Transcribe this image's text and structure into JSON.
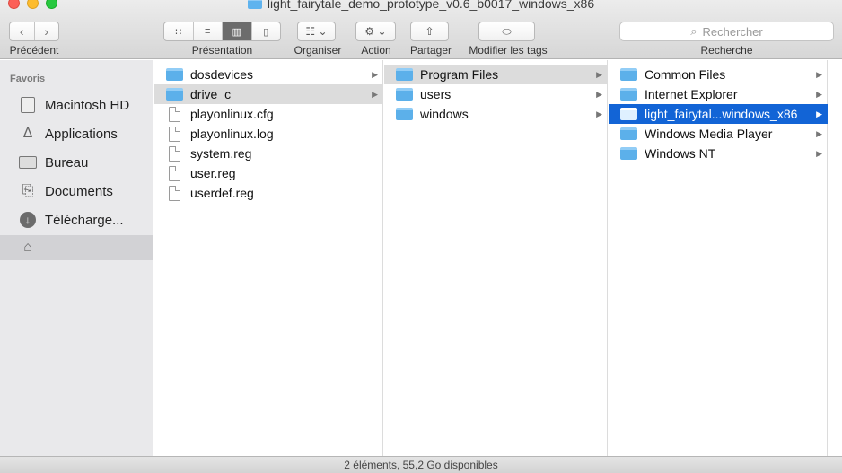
{
  "window": {
    "title": "light_fairytale_demo_prototype_v0.6_b0017_windows_x86"
  },
  "toolbar": {
    "back_label": "Précédent",
    "view_label": "Présentation",
    "arrange_label": "Organiser",
    "action_label": "Action",
    "share_label": "Partager",
    "tags_label": "Modifier les tags",
    "search_label": "Recherche",
    "search_placeholder": "Rechercher"
  },
  "sidebar": {
    "header": "Favoris",
    "items": [
      {
        "label": "Macintosh HD",
        "icon": "hard-drive-icon"
      },
      {
        "label": "Applications",
        "icon": "applications-icon"
      },
      {
        "label": "Bureau",
        "icon": "desktop-icon"
      },
      {
        "label": "Documents",
        "icon": "documents-icon"
      },
      {
        "label": "Télécharge...",
        "icon": "downloads-icon"
      },
      {
        "label": "",
        "icon": "home-icon"
      }
    ]
  },
  "columns": [
    {
      "items": [
        {
          "name": "dosdevices",
          "type": "folder"
        },
        {
          "name": "drive_c",
          "type": "folder",
          "selected": "gray"
        },
        {
          "name": "playonlinux.cfg",
          "type": "file"
        },
        {
          "name": "playonlinux.log",
          "type": "file"
        },
        {
          "name": "system.reg",
          "type": "file"
        },
        {
          "name": "user.reg",
          "type": "file"
        },
        {
          "name": "userdef.reg",
          "type": "file"
        }
      ]
    },
    {
      "items": [
        {
          "name": "Program Files",
          "type": "folder",
          "selected": "gray"
        },
        {
          "name": "users",
          "type": "folder"
        },
        {
          "name": "windows",
          "type": "folder"
        }
      ]
    },
    {
      "items": [
        {
          "name": "Common Files",
          "type": "folder"
        },
        {
          "name": "Internet Explorer",
          "type": "folder"
        },
        {
          "name": "light_fairytal...windows_x86",
          "type": "folder",
          "selected": "blue"
        },
        {
          "name": "Windows Media Player",
          "type": "folder"
        },
        {
          "name": "Windows NT",
          "type": "folder"
        }
      ]
    }
  ],
  "status": {
    "text": "2 éléments, 55,2 Go disponibles"
  },
  "colors": {
    "selection_blue": "#1264d6",
    "folder_blue": "#5cb0ea"
  }
}
